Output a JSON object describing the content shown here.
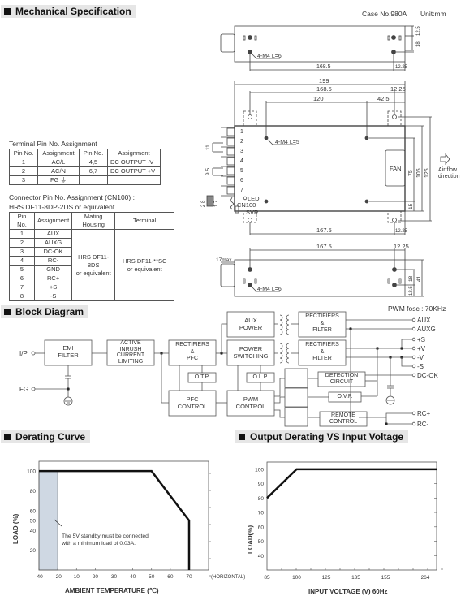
{
  "mechanical": {
    "title": "Mechanical Specification",
    "case_no": "Case No.980A",
    "unit": "Unit:mm",
    "top_view": {
      "dims": [
        "12.5",
        "18",
        "168.5",
        "12.25"
      ],
      "screw_label": "4-M4 L=6"
    },
    "main_view": {
      "dims_top": [
        "199",
        "168.5",
        "12.25",
        "120",
        "42.5"
      ],
      "dims_right": [
        "75",
        "105",
        "125",
        "15"
      ],
      "dims_left": [
        "11",
        "9.5"
      ],
      "screw_label": "4-M4 L=5",
      "terminals": [
        "1",
        "2",
        "3",
        "4",
        "5",
        "6",
        "7"
      ],
      "fan_label": "FAN",
      "led_label": "LED",
      "cn_label": "CN100",
      "svr_label": "SVR",
      "connector_pins": [
        "2",
        "8",
        "1",
        "7"
      ],
      "dims_bottom": [
        "167.5",
        "12.25"
      ],
      "airflow": "Air flow direction"
    },
    "side_view": {
      "dims": [
        "167.5",
        "12.25",
        "17max.",
        "18",
        "41",
        "12.5"
      ],
      "screw_label": "4-M4 L=6"
    }
  },
  "terminal_table": {
    "title": "Terminal Pin No.  Assignment",
    "headers": [
      "Pin No.",
      "Assignment",
      "Pin No.",
      "Assignment"
    ],
    "rows": [
      [
        "1",
        "AC/L",
        "4,5",
        "DC OUTPUT -V"
      ],
      [
        "2",
        "AC/N",
        "6,7",
        "DC OUTPUT +V"
      ],
      [
        "3",
        "FG ⏚",
        "",
        ""
      ]
    ]
  },
  "connector_table": {
    "title_line1": "Connector Pin No. Assignment (CN100) :",
    "title_line2": "HRS DF11-8DP-2DS or equivalent",
    "headers": [
      "Pin No.",
      "Assignment",
      "Mating Housing",
      "Terminal"
    ],
    "rows": [
      [
        "1",
        "AUX"
      ],
      [
        "2",
        "AUXG"
      ],
      [
        "3",
        "DC-OK"
      ],
      [
        "4",
        "RC-"
      ],
      [
        "5",
        "GND"
      ],
      [
        "6",
        "RC+"
      ],
      [
        "7",
        "+S"
      ],
      [
        "8",
        "-S"
      ]
    ],
    "housing_line1": "HRS DF11-8DS",
    "housing_line2": "or equivalent",
    "terminal_line1": "HRS DF11-**SC",
    "terminal_line2": "or equivalent"
  },
  "block_diagram": {
    "title": "Block Diagram",
    "pwm_note": "PWM  fosc : 70KHz",
    "inputs": [
      "I/P",
      "FG"
    ],
    "blocks": {
      "emi": [
        "EMI",
        "FILTER"
      ],
      "inrush": [
        "ACTIVE",
        "INRUSH",
        "CURRENT",
        "LIMITING"
      ],
      "rect_pfc": [
        "RECTIFIERS",
        "&",
        "PFC"
      ],
      "otp": [
        "O.T.P."
      ],
      "pfc_ctrl": [
        "PFC",
        "CONTROL"
      ],
      "aux_power": [
        "AUX",
        "POWER"
      ],
      "power_sw": [
        "POWER",
        "SWITCHING"
      ],
      "olp": [
        "O.L.P."
      ],
      "pwm_ctrl": [
        "PWM",
        "CONTROL"
      ],
      "rect_filter1": [
        "RECTIFIERS",
        "&",
        "FILTER"
      ],
      "rect_filter2": [
        "RECTIFIERS",
        "&",
        "FILTER"
      ],
      "detection": [
        "DETECTION",
        "CIRCUIT"
      ],
      "ovp": [
        "O.V.P."
      ],
      "remote": [
        "REMOTE",
        "CONTROL"
      ]
    },
    "outputs": [
      "AUX",
      "AUXG",
      "+S",
      "+V",
      "-V",
      "-S",
      "DC-OK",
      "RC+",
      "RC-"
    ]
  },
  "chart_data": [
    {
      "type": "line",
      "title": "Derating Curve",
      "xlabel": "AMBIENT TEMPERATURE (℃)",
      "ylabel": "LOAD (%)",
      "x_note": "(HORIZONTAL)",
      "x_ticks": [
        -40,
        -20,
        10,
        20,
        30,
        40,
        50,
        60,
        70
      ],
      "y_ticks": [
        20,
        40,
        50,
        60,
        80,
        100
      ],
      "ylim": [
        0,
        110
      ],
      "series": [
        {
          "name": "Load",
          "points": [
            [
              -40,
              100
            ],
            [
              50,
              100
            ],
            [
              70,
              50
            ],
            [
              70,
              0
            ]
          ]
        }
      ],
      "shaded_region": {
        "x_from": -40,
        "x_to": -20,
        "color": "#cfd8e3"
      },
      "annotation": [
        "The 5V standby must be connected",
        "with a minimum load of 0.03A."
      ]
    },
    {
      "type": "line",
      "title": "Output Derating VS Input Voltage",
      "xlabel": "INPUT VOLTAGE (V) 60Hz",
      "ylabel": "LOAD(%)",
      "x_ticks": [
        "85",
        "100",
        "125",
        "135",
        "155",
        "264"
      ],
      "y_ticks": [
        40,
        50,
        60,
        70,
        80,
        90,
        100
      ],
      "ylim": [
        30,
        105
      ],
      "series": [
        {
          "name": "Load",
          "points": [
            [
              "85",
              80
            ],
            [
              "100",
              100
            ],
            [
              "264+",
              100
            ]
          ]
        }
      ]
    }
  ]
}
